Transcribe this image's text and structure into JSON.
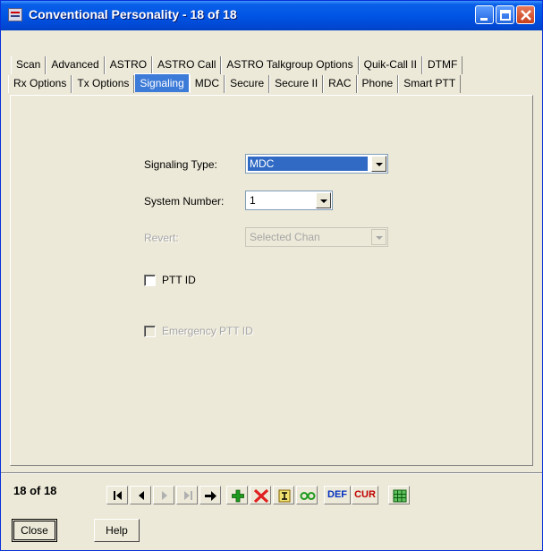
{
  "window": {
    "title": "Conventional Personality - 18 of 18"
  },
  "tabs": {
    "row1": [
      "Scan",
      "Advanced",
      "ASTRO",
      "ASTRO Call",
      "ASTRO Talkgroup Options",
      "Quik-Call II",
      "DTMF"
    ],
    "row2": [
      "Rx Options",
      "Tx Options",
      "Signaling",
      "MDC",
      "Secure",
      "Secure II",
      "RAC",
      "Phone",
      "Smart PTT"
    ],
    "active": "Signaling"
  },
  "form": {
    "signaling_type": {
      "label": "Signaling Type:",
      "value": "MDC"
    },
    "system_number": {
      "label": "System Number:",
      "value": "1"
    },
    "revert": {
      "label": "Revert:",
      "value": "Selected Chan",
      "disabled": true
    },
    "ptt_id": {
      "label": "PTT ID",
      "checked": false
    },
    "emergency_ptt_id": {
      "label": "Emergency PTT ID",
      "checked": false,
      "disabled": true
    }
  },
  "navigator": {
    "counter": "18 of 18",
    "def_label": "DEF",
    "cur_label": "CUR"
  },
  "buttons": {
    "close": "Close",
    "help": "Help"
  },
  "colors": {
    "titlebar": "#0055e5",
    "active_tab": "#3d7bd8",
    "selection": "#316ac5",
    "add_icon": "#1e9a1e",
    "delete_icon": "#e02020",
    "def_text": "#0030c0",
    "cur_text": "#c00000"
  }
}
